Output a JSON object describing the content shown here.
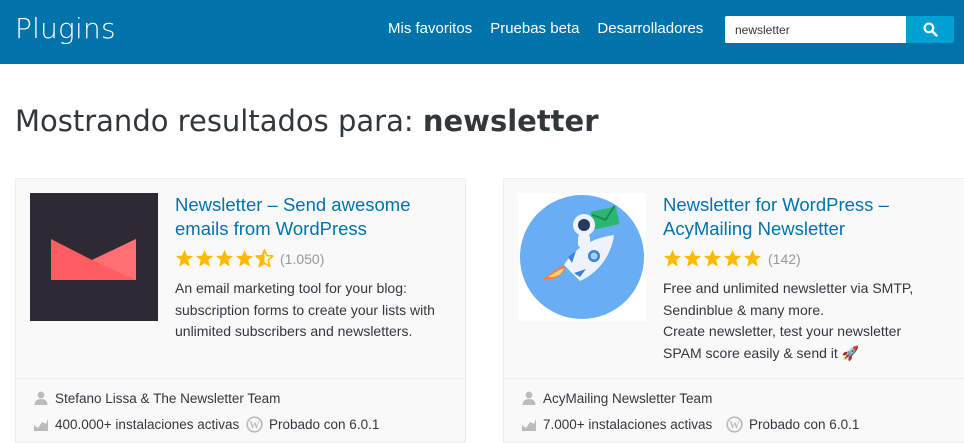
{
  "header": {
    "brand": "Plugins",
    "nav": [
      "Mis favoritos",
      "Pruebas beta",
      "Desarrolladores"
    ],
    "search_value": "newsletter"
  },
  "results": {
    "prefix": "Mostrando resultados para:",
    "query": "newsletter"
  },
  "plugins": [
    {
      "title": "Newsletter – Send awesome emails from WordPress",
      "rating": 4.5,
      "rating_count": "(1.050)",
      "description": "An email marketing tool for your blog: subscription forms to create your lists with unlimited subscribers and newsletters.",
      "author": "Stefano Lissa & The Newsletter Team",
      "installs": "400.000+ instalaciones activas",
      "tested": "Probado con 6.0.1"
    },
    {
      "title": "Newsletter for WordPress – AcyMailing Newsletter",
      "rating": 5,
      "rating_count": "(142)",
      "description_lines": [
        "Free and unlimited newsletter via SMTP, Sendinblue & many more.",
        "Create newsletter, test your newsletter SPAM score easily & send it 🚀"
      ],
      "author": "AcyMailing Newsletter Team",
      "installs": "7.000+ instalaciones activas",
      "tested": "Probado con 6.0.1"
    }
  ],
  "colors": {
    "header_bg": "#0073aa",
    "search_button": "#00a0d2",
    "link": "#0073aa",
    "star": "#ffb900"
  },
  "icons": [
    "search-icon",
    "star-icon",
    "star-half-icon",
    "user-icon",
    "chart-icon",
    "wordpress-icon"
  ]
}
